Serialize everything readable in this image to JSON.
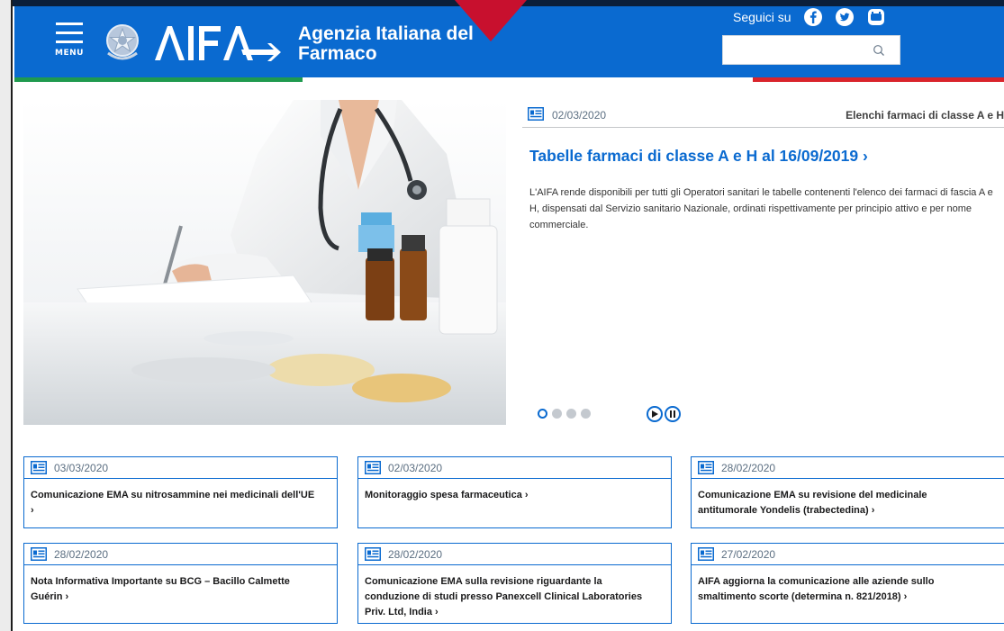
{
  "header": {
    "menu_label": "MENU",
    "agency_name_line1": "Agenzia Italiana del",
    "agency_name_line2": "Farmaco",
    "follow_label": "Seguici su",
    "social_icons": [
      "facebook-icon",
      "twitter-icon",
      "youtube-icon"
    ],
    "search_value": "",
    "search_placeholder": ""
  },
  "colors": {
    "brand_blue": "#0a6ad0",
    "green": "#1f9a4e",
    "red": "#d9242b",
    "marker_red": "#c8102e"
  },
  "hero": {
    "date": "02/03/2020",
    "category": "Elenchi farmaci di classe A e H",
    "title": "Tabelle farmaci di classe A e H al 16/09/2019",
    "description": "L'AIFA rende disponibili per tutti gli Operatori sanitari le tabelle contenenti l'elenco dei farmaci di fascia A e H, dispensati dal Servizio sanitario Nazionale, ordinati rispettivamente per principio attivo e per nome commerciale.",
    "slides_total": 4,
    "active_slide": 1
  },
  "news": [
    {
      "date": "03/03/2020",
      "title": "Comunicazione EMA su nitrosammine nei medicinali dell'UE"
    },
    {
      "date": "02/03/2020",
      "title": "Monitoraggio spesa farmaceutica"
    },
    {
      "date": "28/02/2020",
      "title": "Comunicazione EMA su revisione del medicinale antitumorale Yondelis (trabectedina)"
    },
    {
      "date": "28/02/2020",
      "title": "Nota Informativa Importante su BCG – Bacillo Calmette Guérin"
    },
    {
      "date": "28/02/2020",
      "title": "Comunicazione EMA sulla revisione riguardante la conduzione di studi presso Panexcell Clinical Laboratories Priv. Ltd, India"
    },
    {
      "date": "27/02/2020",
      "title": "AIFA aggiorna la comunicazione alle aziende sullo smaltimento scorte (determina n. 821/2018)"
    }
  ]
}
